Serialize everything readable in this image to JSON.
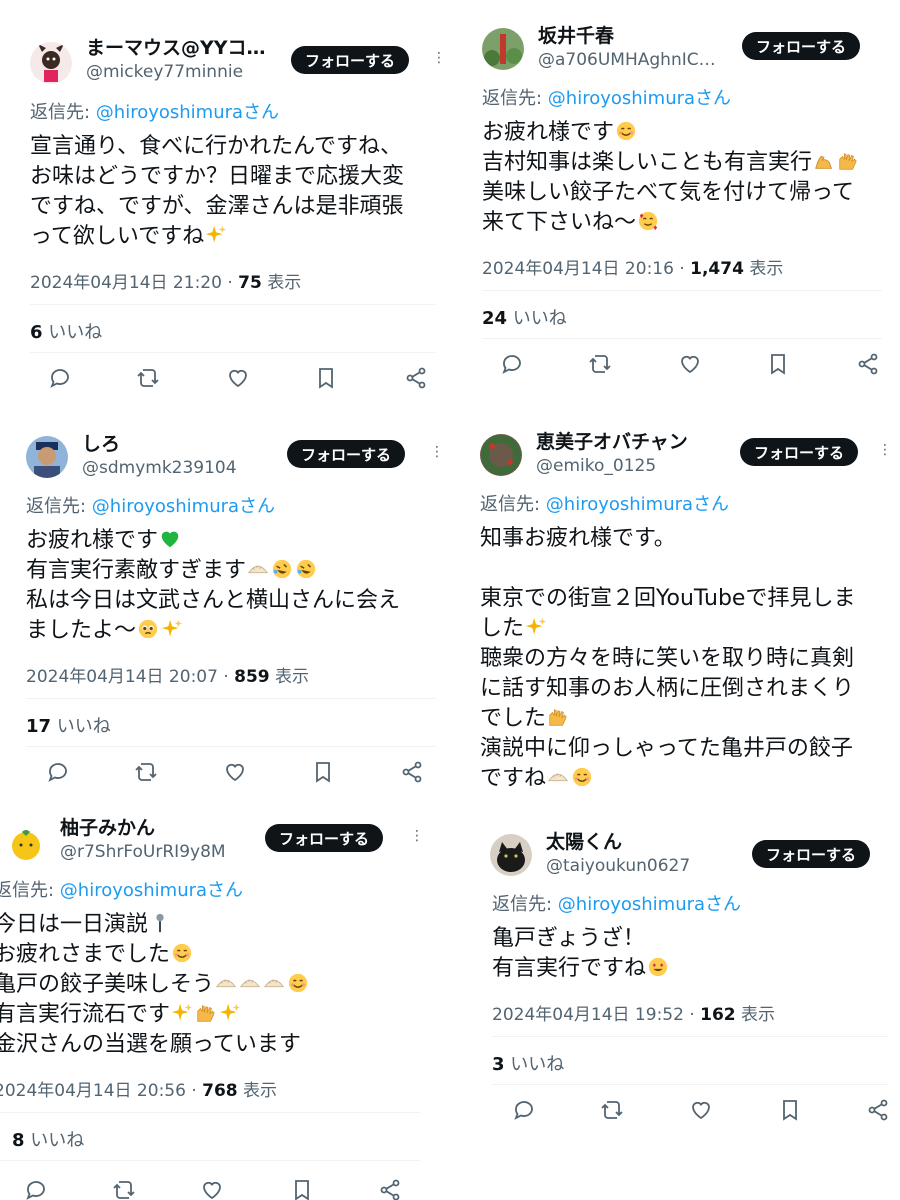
{
  "follow_label": "フォローする",
  "reply_prefix": "返信先: ",
  "views_suffix": " 表示",
  "likes_suffix": " いいね",
  "tweets": [
    {
      "name": "まーマウス@YYコ…",
      "handle": "@mickey77minnie",
      "reply_to": "@hiroyoshimuraさん",
      "lines": [
        "宣言通り、食べに行かれたんですね、",
        "お味はどうですか？日曜まで応援大変",
        "ですね、ですが、金澤さんは是非頑張",
        "って欲しいですね"
      ],
      "datetime": "2024年04月14日 21:20 · ",
      "views": "75",
      "likes": "6"
    },
    {
      "name": "坂井千春",
      "handle": "@a706UMHAghnIC…",
      "reply_to": "@hiroyoshimuraさん",
      "lines": [
        "お疲れ様です",
        "吉村知事は楽しいことも有言実行",
        "美味しい餃子たべて気を付けて帰って",
        "来て下さいね〜"
      ],
      "datetime": "2024年04月14日 20:16 · ",
      "views": "1,474",
      "likes": "24"
    },
    {
      "name": "しろ",
      "handle": "@sdmymk239104",
      "reply_to": "@hiroyoshimuraさん",
      "lines": [
        "お疲れ様です",
        "有言実行素敵すぎます",
        "私は今日は文武さんと横山さんに会え",
        "ましたよ〜"
      ],
      "datetime": "2024年04月14日 20:07 · ",
      "views": "859",
      "likes": "17"
    },
    {
      "name": "恵美子オバチャン",
      "handle": "@emiko_0125",
      "reply_to": "@hiroyoshimuraさん",
      "lines": [
        "知事お疲れ様です。",
        "",
        "東京での街宣２回YouTubeで拝見しま",
        "した",
        "聴衆の方々を時に笑いを取り時に真剣",
        "に話す知事のお人柄に圧倒されまくり",
        "でした",
        "演説中に仰っしゃってた亀井戸の餃子",
        "ですね"
      ]
    },
    {
      "name": "柚子みかん",
      "handle": "@r7ShrFoUrRI9y8M",
      "reply_to": "@hiroyoshimuraさん",
      "lines": [
        "今日は一日演説",
        "お疲れさまでした",
        "亀戸の餃子美味しそう",
        "有言実行流石です",
        "金沢さんの当選を願っています"
      ],
      "datetime": "2024年04月14日 20:56 · ",
      "views": "768",
      "likes": "8"
    },
    {
      "name": "太陽くん",
      "handle": "@taiyoukun0627",
      "reply_to": "@hiroyoshimuraさん",
      "lines": [
        "亀戸ぎょうざ！",
        "有言実行ですね"
      ],
      "datetime": "2024年04月14日 19:52 · ",
      "views": "162",
      "likes": "3"
    }
  ],
  "icons": {
    "actions": [
      "reply-icon",
      "retweet-icon",
      "like-icon",
      "bookmark-icon",
      "share-icon"
    ],
    "emoji": [
      "sparkles",
      "smiling-face",
      "flexed-biceps",
      "raising-hands",
      "smiling-hearts",
      "green-heart",
      "dumpling",
      "rofl",
      "pleading-face",
      "microphone",
      "heart-eyes"
    ]
  },
  "colors": {
    "accent": "#1d9bf0",
    "text": "#0f1419",
    "muted": "#536471",
    "divider": "#eff3f4"
  }
}
